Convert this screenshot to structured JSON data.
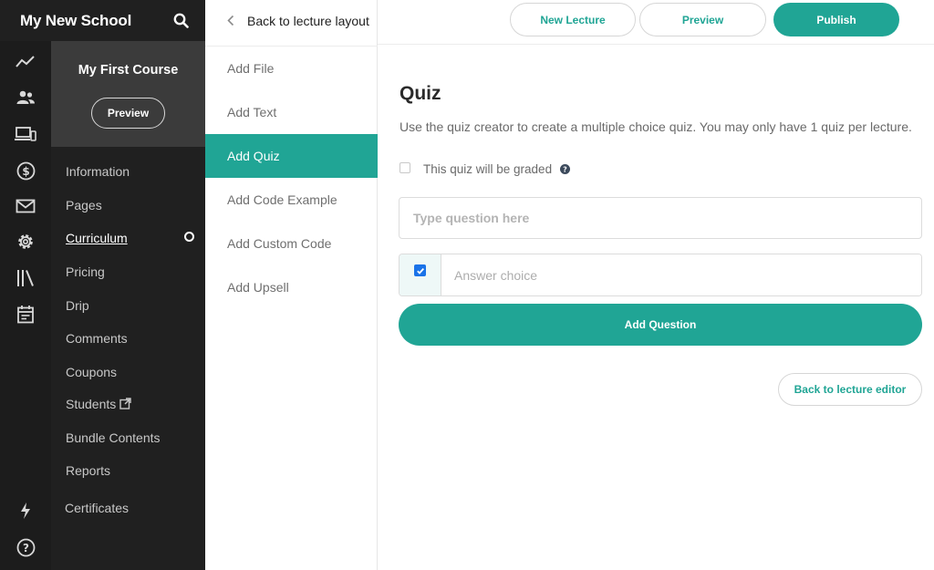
{
  "school": {
    "name": "My New School"
  },
  "rail_icons": [
    "trend-line-icon",
    "users-icon",
    "devices-icon",
    "dollar-icon",
    "mail-icon",
    "gear-icon",
    "library-icon",
    "calendar-icon",
    "lightning-icon",
    "help-circle-icon"
  ],
  "course": {
    "title": "My First Course",
    "preview_label": "Preview"
  },
  "course_nav": {
    "items": [
      {
        "label": "Information"
      },
      {
        "label": "Pages"
      },
      {
        "label": "Curriculum",
        "active": true
      },
      {
        "label": "Pricing"
      },
      {
        "label": "Drip"
      },
      {
        "label": "Comments"
      },
      {
        "label": "Coupons"
      },
      {
        "label": "Students",
        "external": true
      },
      {
        "label": "Bundle Contents"
      },
      {
        "label": "Reports"
      },
      {
        "label": "Certificates"
      }
    ]
  },
  "lecture_panel": {
    "back_label": "Back to lecture layout",
    "blocks": [
      {
        "label": "Add File"
      },
      {
        "label": "Add Text"
      },
      {
        "label": "Add Quiz",
        "selected": true
      },
      {
        "label": "Add Code Example"
      },
      {
        "label": "Add Custom Code"
      },
      {
        "label": "Add Upsell"
      }
    ]
  },
  "toolbar": {
    "new_lecture_label": "New Lecture",
    "preview_label": "Preview",
    "publish_label": "Publish"
  },
  "quiz": {
    "title": "Quiz",
    "description": "Use the quiz creator to create a multiple choice quiz. You may only have 1 quiz per lecture.",
    "graded_label": "This quiz will be graded",
    "graded_checked": false,
    "question_placeholder": "Type question here",
    "answer_placeholder": "Answer choice",
    "answer_correct_checked": true,
    "add_question_label": "Add Question",
    "back_to_editor_label": "Back to lecture editor"
  },
  "colors": {
    "sidebar_bg": "#202020",
    "accent": "#20a595",
    "checkbox_blue": "#1a73e8"
  }
}
